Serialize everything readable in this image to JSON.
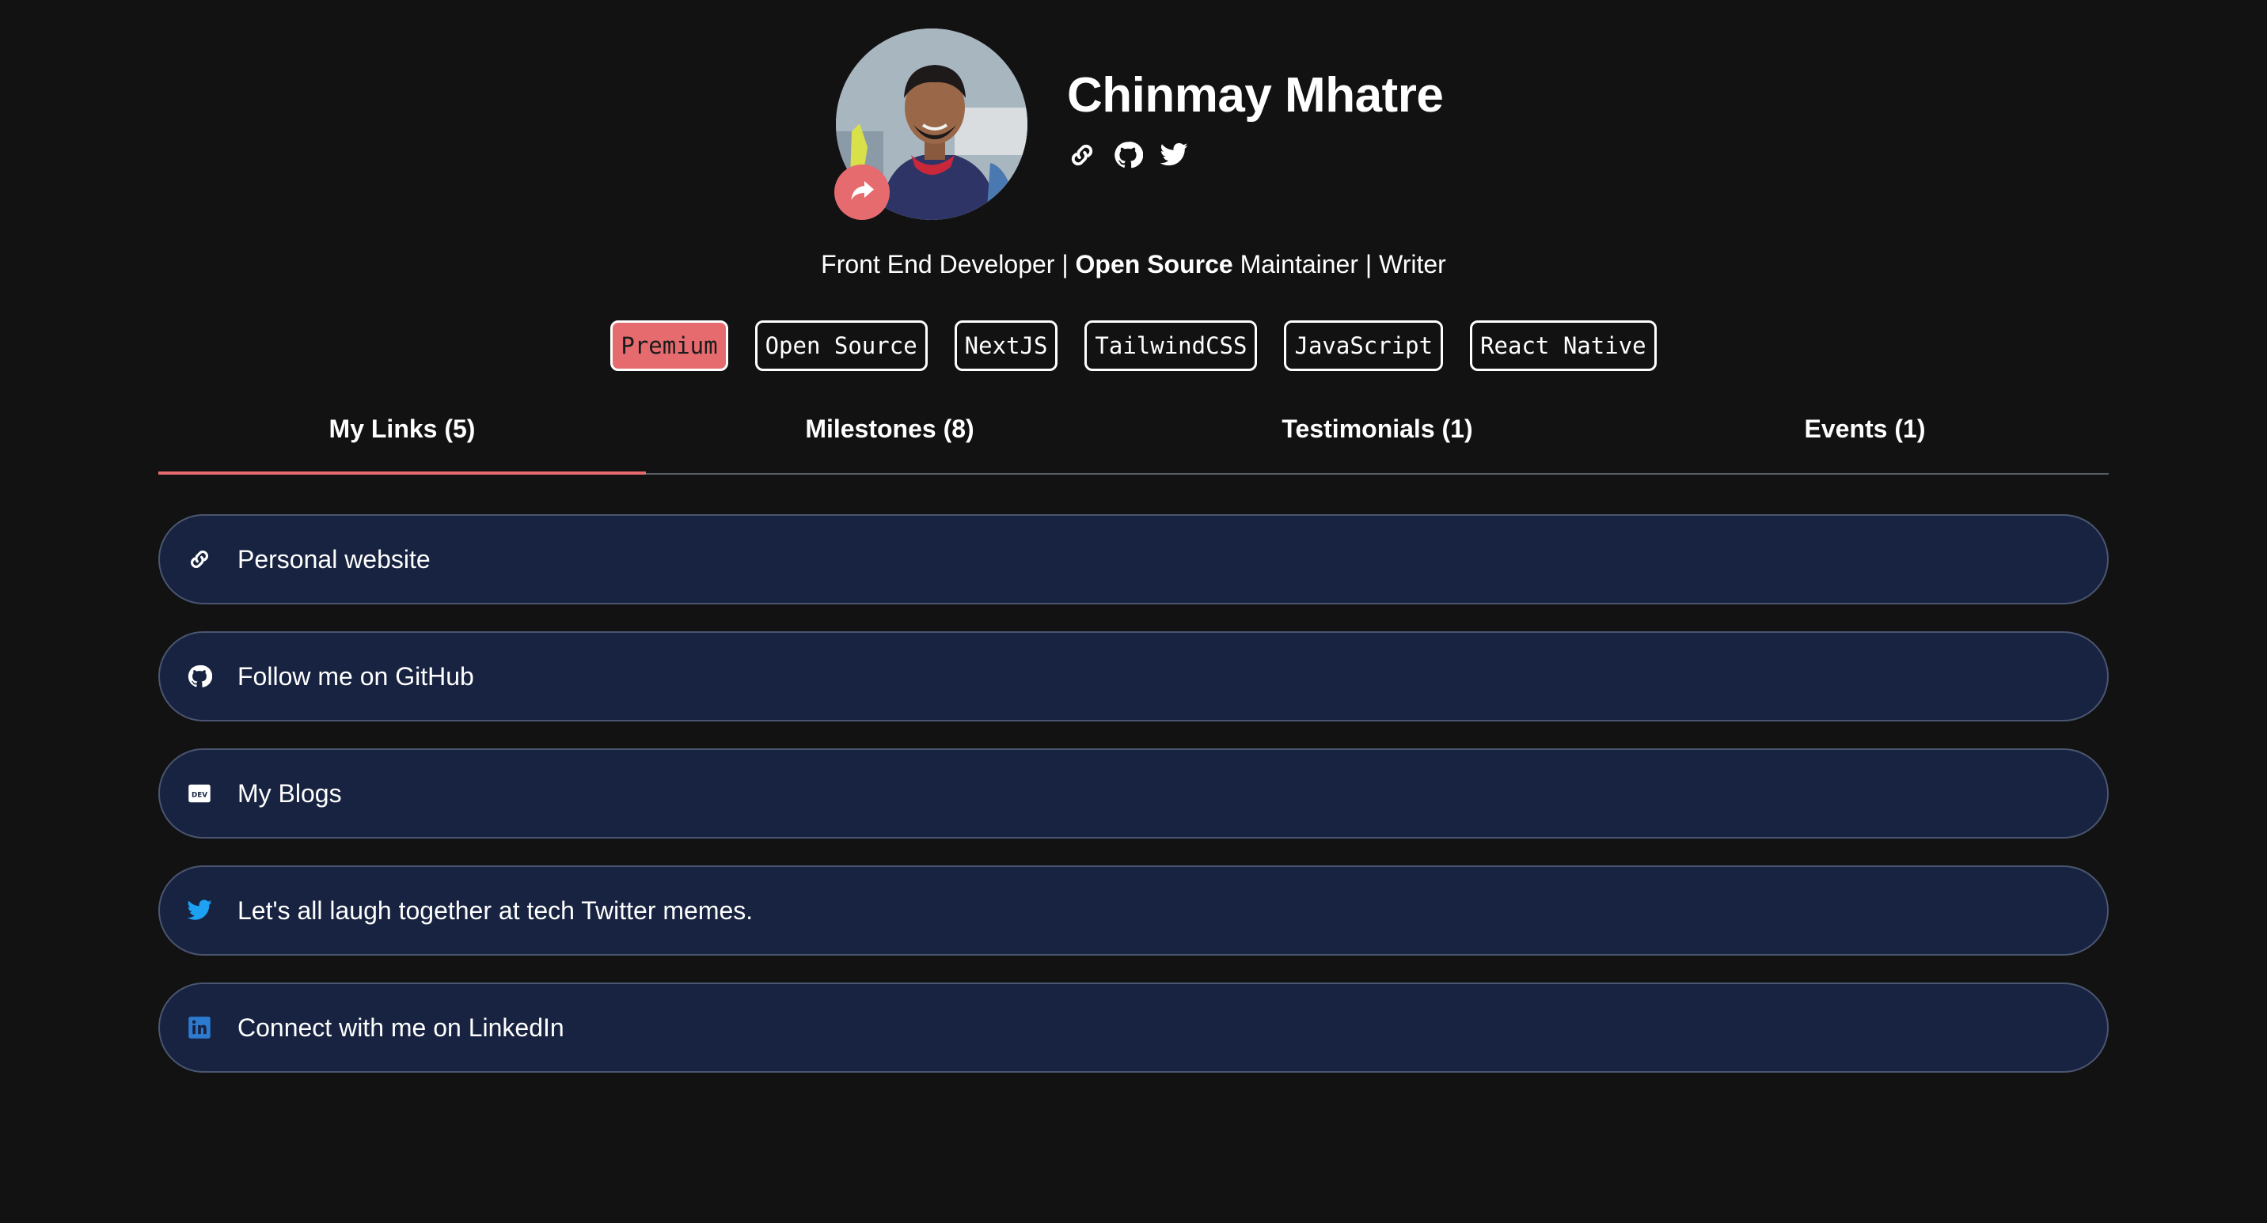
{
  "profile": {
    "name": "Chinmay Mhatre",
    "social_icons": [
      "link-icon",
      "github-icon",
      "twitter-icon"
    ]
  },
  "bio": {
    "part1": "Front End Developer | ",
    "bold": "Open Source",
    "part2": " Maintainer | Writer"
  },
  "tags": [
    {
      "label": "Premium",
      "highlighted": true
    },
    {
      "label": "Open Source"
    },
    {
      "label": "NextJS"
    },
    {
      "label": "TailwindCSS"
    },
    {
      "label": "JavaScript"
    },
    {
      "label": "React Native"
    }
  ],
  "tabs": [
    {
      "label": "My Links (5)",
      "active": true
    },
    {
      "label": "Milestones (8)"
    },
    {
      "label": "Testimonials (1)"
    },
    {
      "label": "Events (1)"
    }
  ],
  "links": [
    {
      "label": "Personal website",
      "icon": "link-icon"
    },
    {
      "label": "Follow me on GitHub",
      "icon": "github-icon"
    },
    {
      "label": "My Blogs",
      "icon": "dev-icon"
    },
    {
      "label": "Let's all laugh together at tech Twitter memes.",
      "icon": "twitter-icon",
      "icon_color": "#1da1f2"
    },
    {
      "label": "Connect with me on LinkedIn",
      "icon": "linkedin-icon",
      "icon_color": "#2d7bd1"
    }
  ],
  "colors": {
    "background": "#121212",
    "accent": "#e56b6f",
    "card": "#172340"
  }
}
